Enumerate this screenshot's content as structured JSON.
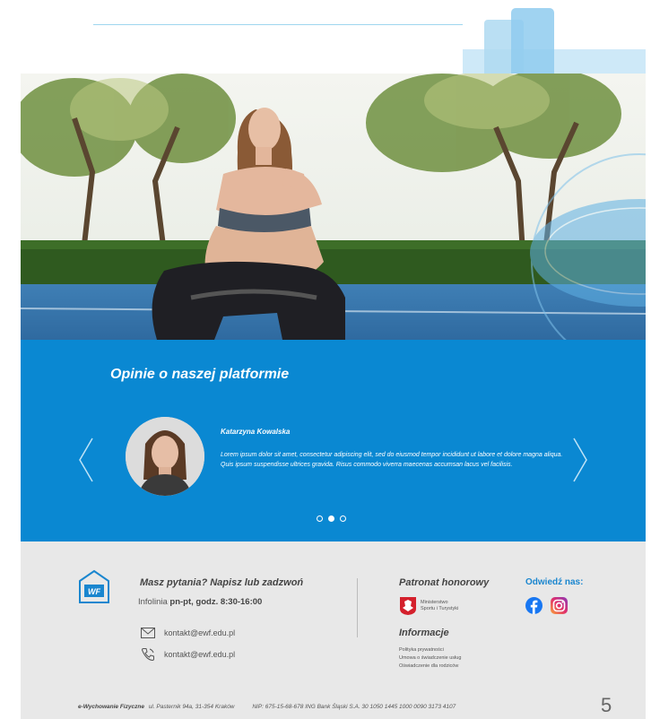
{
  "testimonials": {
    "title": "Opinie o naszej platformie",
    "review": {
      "name": "Katarzyna Kowalska",
      "text": "Lorem ipsum dolor sit amet, consectetur adipiscing elit, sed do eiusmod tempor incididunt ut labore et dolore magna aliqua. Quis ipsum suspendisse ultrices gravida. Risus commodo viverra maecenas accumsan lacus vel facilisis."
    },
    "slides_total": 3,
    "active_slide": 2
  },
  "footer": {
    "contact": {
      "title": "Masz pytania? Napisz lub zadzwoń",
      "hotline_prefix": "Infolinia",
      "hotline_hours": "pn-pt, godz. 8:30-16:00",
      "email": "kontakt@ewf.edu.pl",
      "phone": "kontakt@ewf.edu.pl"
    },
    "patronage": {
      "title": "Patronat honorowy",
      "ministry_line1": "Ministerstwo",
      "ministry_line2": "Sportu i Turystyki"
    },
    "visit": {
      "title": "Odwiedź nas:"
    },
    "info": {
      "title": "Informacje",
      "links": [
        "Polityka prywatności",
        "Umowa o świadczenie usług",
        "Oświadczenie dla rodziców"
      ]
    },
    "bottom": {
      "brand": "e-Wychowanie Fizyczne",
      "address": "ul. Pasternik 94a, 31-354 Kraków",
      "bank": "NIP: 675-15-68-678 ING Bank Śląski S.A. 30 1050 1445 1000 0090 3173 4107"
    },
    "page_number": "5"
  },
  "colors": {
    "brand_blue": "#0a88d2",
    "footer_bg": "#e8e8e8",
    "accent_light": "#9fd6ef"
  },
  "icons": {
    "arrow_left": "chevron-left-icon",
    "arrow_right": "chevron-right-icon",
    "email": "envelope-icon",
    "phone": "phone-icon",
    "facebook": "facebook-icon",
    "instagram": "instagram-icon"
  }
}
